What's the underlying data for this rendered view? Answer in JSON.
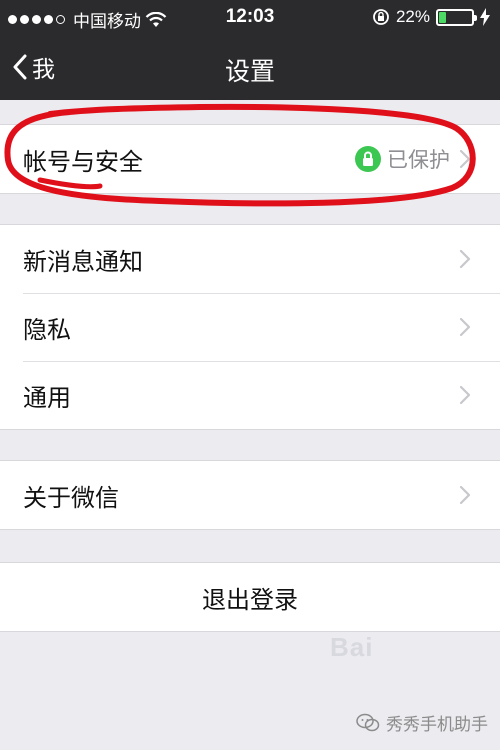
{
  "status_bar": {
    "carrier": "中国移动",
    "time": "12:03",
    "battery_percent": "22%",
    "battery_level": 0.22,
    "icons": [
      "signal-dots-icon",
      "wifi-icon",
      "rotation-lock-icon",
      "battery-icon",
      "charging-icon"
    ]
  },
  "nav": {
    "back_label": "我",
    "title": "设置"
  },
  "account_group": {
    "items": [
      {
        "label": "帐号与安全",
        "status": "已保护",
        "status_icon": "lock-icon"
      }
    ]
  },
  "settings_group": {
    "items": [
      {
        "label": "新消息通知"
      },
      {
        "label": "隐私"
      },
      {
        "label": "通用"
      }
    ]
  },
  "about_group": {
    "items": [
      {
        "label": "关于微信"
      }
    ]
  },
  "logout": {
    "label": "退出登录"
  },
  "watermark": {
    "text": "秀秀手机助手",
    "brand": "Bai"
  },
  "colors": {
    "nav_bg": "#2b2b2e",
    "page_bg": "#ebebf0",
    "protected_green": "#3cc652",
    "annotation_red": "#e0101a"
  }
}
